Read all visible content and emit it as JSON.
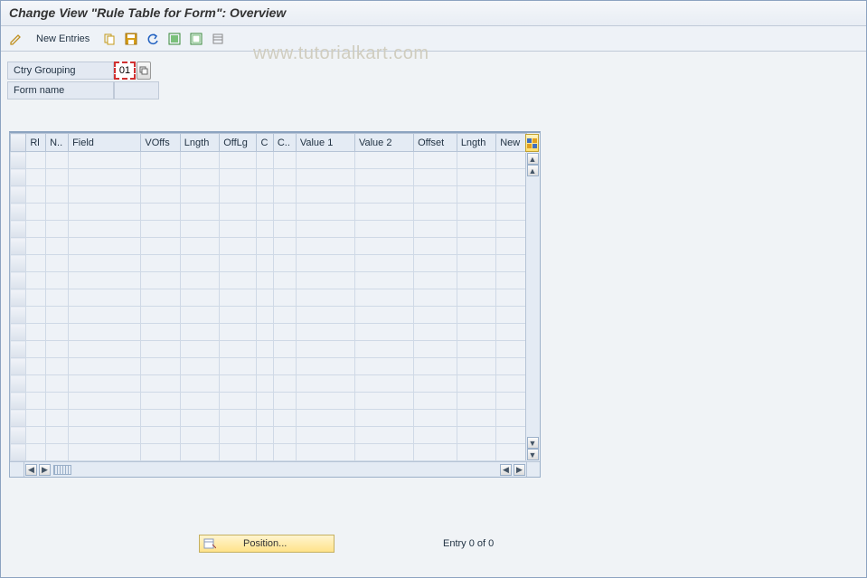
{
  "title": "Change View \"Rule Table for Form\": Overview",
  "toolbar": {
    "new_entries": "New Entries"
  },
  "watermark": "www.tutorialkart.com",
  "form": {
    "ctry_grouping_label": "Ctry Grouping",
    "ctry_grouping_value": "01",
    "form_name_label": "Form name",
    "form_name_value": ""
  },
  "table": {
    "columns": [
      "Rl",
      "N..",
      "Field",
      "VOffs",
      "Lngth",
      "OffLg",
      "C",
      "C..",
      "Value 1",
      "Value 2",
      "Offset",
      "Lngth",
      "New"
    ],
    "row_count": 18
  },
  "footer": {
    "position_label": "Position...",
    "entry_text": "Entry 0 of 0"
  }
}
